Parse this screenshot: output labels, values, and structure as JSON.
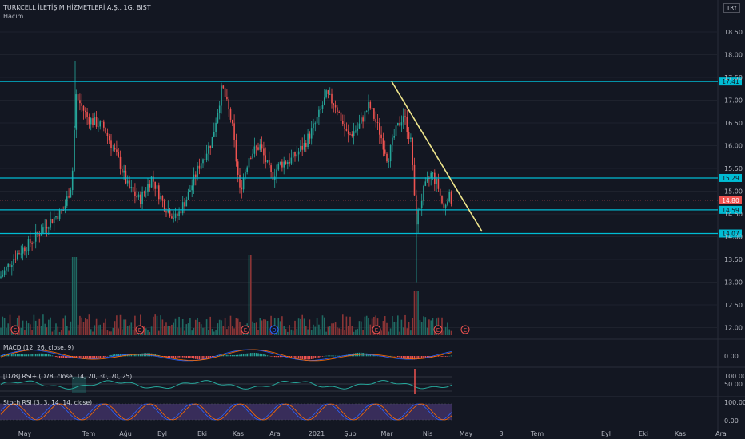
{
  "header": {
    "title": "TURKCELL İLETİŞİM HİZMETLERİ A.Ş., 1G, BIST",
    "volume_label": "Hacim",
    "currency": "TRY"
  },
  "indicators": {
    "macd_label": "MACD (12, 26, close, 9)",
    "dtr_label": "[D78] RSI+ (D78, close, 14, 20, 30, 70, 25)",
    "stoch_label": "Stoch RSI (3, 3, 14, 14, close)"
  },
  "colors": {
    "background": "#131722",
    "up": "#26a69a",
    "down": "#ef5350",
    "support_line": "#00bcd4",
    "trend_line": "#f0e68c",
    "stoch_band": "#7e57c2"
  },
  "chart_data": {
    "type": "candlestick",
    "y_ticks": [
      "18.50",
      "18.00",
      "17.50",
      "17.00",
      "16.50",
      "16.00",
      "15.50",
      "15.00",
      "14.50",
      "14.00",
      "13.50",
      "13.00",
      "12.50",
      "12.00"
    ],
    "x_ticks": [
      "May",
      "Tem",
      "Ağu",
      "Eyl",
      "Eki",
      "Kas",
      "Ara",
      "2021",
      "Şub",
      "Mar",
      "Nis",
      "May",
      "3",
      "Tem",
      "Eyl",
      "Eki",
      "Kas",
      "Ara"
    ],
    "horizontal_levels": [
      "17.41",
      "15.29",
      "14.59",
      "14.07"
    ],
    "last_price": "14.80",
    "macd_ticks": [
      "0.00"
    ],
    "dtr_ticks": [
      "100.00",
      "50.00"
    ],
    "stoch_ticks": [
      "100.00",
      "0.00"
    ],
    "event_markers": [
      "E",
      "E",
      "E",
      "D",
      "E",
      "E",
      "E"
    ]
  }
}
